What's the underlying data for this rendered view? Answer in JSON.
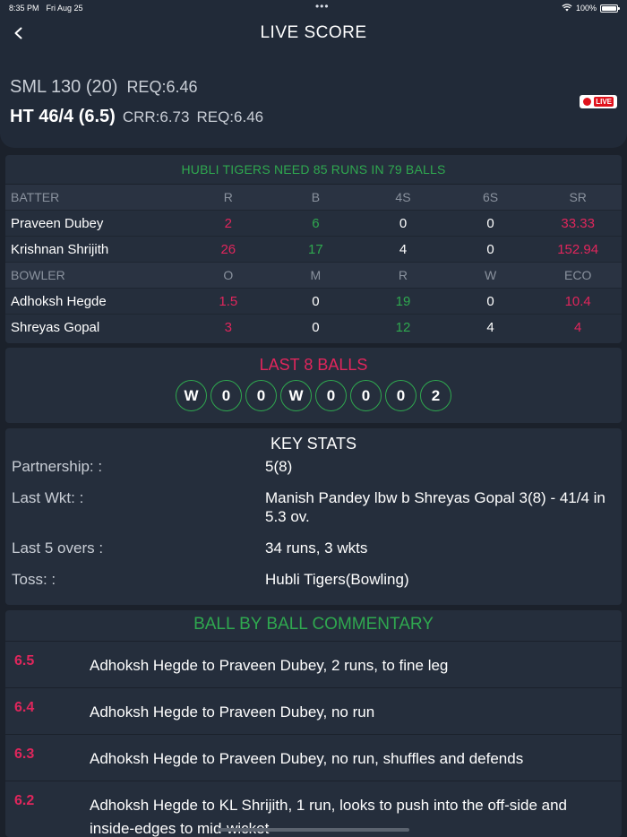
{
  "status": {
    "time": "8:35 PM",
    "date": "Fri Aug 25",
    "battery": "100%"
  },
  "header": {
    "title": "LIVE SCORE",
    "team1": "SML 130 (20)",
    "team1_req": "REQ:6.46",
    "team2": "HT 46/4 (6.5)",
    "team2_crr": "CRR:6.73",
    "team2_req": "REQ:6.46",
    "live_label": "LIVE"
  },
  "target_text": "HUBLI TIGERS NEED 85 RUNS IN 79 BALLS",
  "batters": {
    "headers": [
      "BATTER",
      "R",
      "B",
      "4S",
      "6S",
      "SR"
    ],
    "rows": [
      [
        "Praveen Dubey",
        "2",
        "6",
        "0",
        "0",
        "33.33"
      ],
      [
        "Krishnan Shrijith",
        "26",
        "17",
        "4",
        "0",
        "152.94"
      ]
    ]
  },
  "bowlers": {
    "headers": [
      "BOWLER",
      "O",
      "M",
      "R",
      "W",
      "ECO"
    ],
    "rows": [
      [
        "Adhoksh Hegde",
        "1.5",
        "0",
        "19",
        "0",
        "10.4"
      ],
      [
        "Shreyas Gopal",
        "3",
        "0",
        "12",
        "4",
        "4"
      ]
    ]
  },
  "last_balls": {
    "title": "LAST 8 BALLS",
    "balls": [
      "W",
      "0",
      "0",
      "W",
      "0",
      "0",
      "0",
      "2"
    ]
  },
  "key_stats": {
    "title": "KEY STATS",
    "rows": [
      {
        "label": "Partnership:  :",
        "value": "5(8)"
      },
      {
        "label": "Last Wkt:  :",
        "value": "Manish Pandey lbw b Shreyas Gopal 3(8) - 41/4 in 5.3 ov."
      },
      {
        "label": "Last 5 overs  :",
        "value": "34 runs, 3 wkts"
      },
      {
        "label": "Toss:  :",
        "value": "Hubli Tigers(Bowling)"
      }
    ]
  },
  "commentary": {
    "title": "BALL BY BALL COMMENTARY",
    "items": [
      {
        "over": "6.5",
        "text": "Adhoksh Hegde to Praveen Dubey, 2 runs, to fine leg"
      },
      {
        "over": "6.4",
        "text": "Adhoksh Hegde to Praveen Dubey, no run"
      },
      {
        "over": "6.3",
        "text": "Adhoksh Hegde to Praveen Dubey, no run, shuffles and defends"
      },
      {
        "over": "6.2",
        "text": "Adhoksh Hegde to KL Shrijith, 1 run, looks to push into the off-side and inside-edges to mid-wicket"
      }
    ]
  },
  "colors": {
    "accent_red": "#e0265c",
    "accent_green": "#2fa84f",
    "background": "#1b212b",
    "card": "#252e3c"
  },
  "icons": {
    "back": "chevron-left-icon",
    "wifi": "wifi-icon",
    "battery": "battery-icon",
    "live": "live-dot-icon"
  }
}
